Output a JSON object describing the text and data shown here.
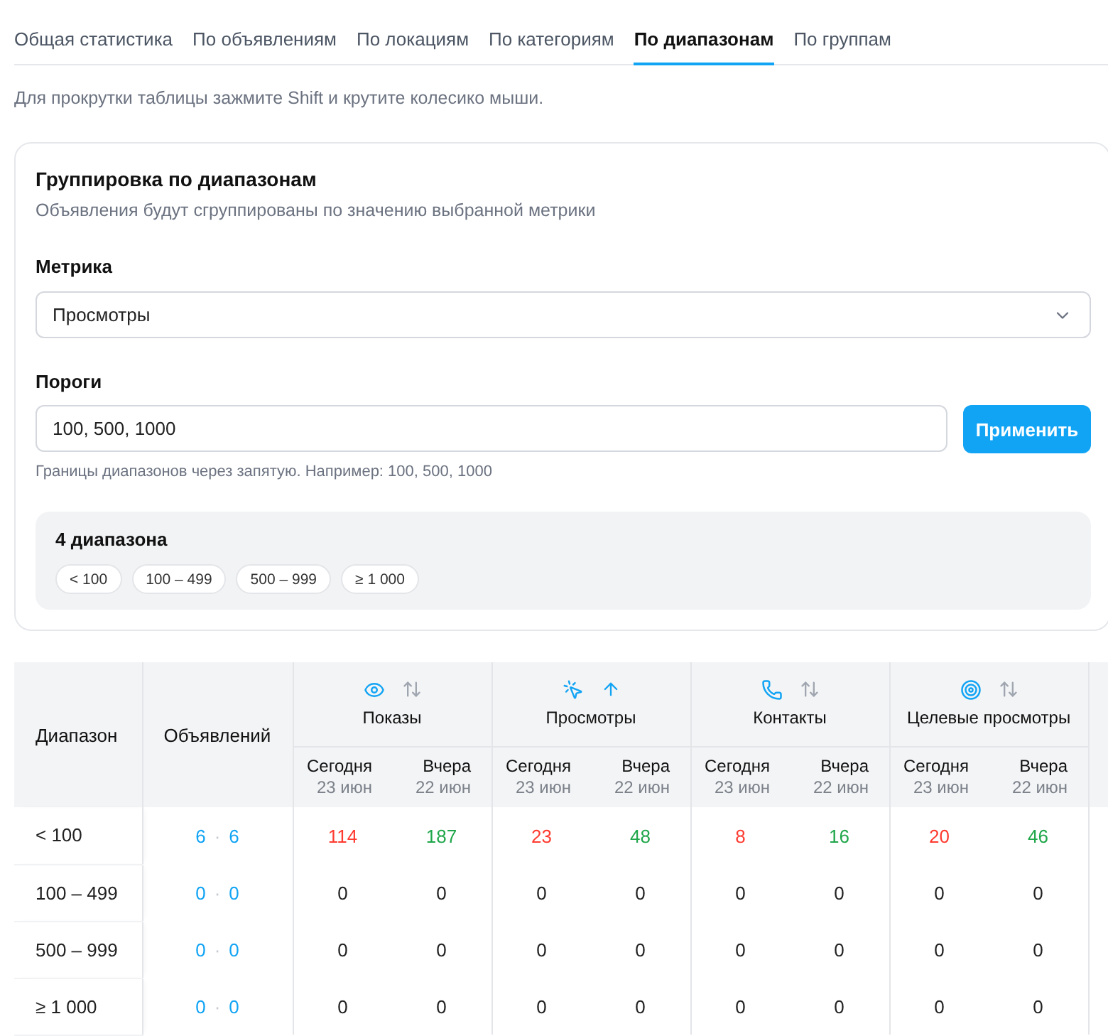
{
  "tabs": [
    {
      "label": "Общая статистика",
      "selected": false
    },
    {
      "label": "По объявлениям",
      "selected": false
    },
    {
      "label": "По локациям",
      "selected": false
    },
    {
      "label": "По категориям",
      "selected": false
    },
    {
      "label": "По диапазонам",
      "selected": true
    },
    {
      "label": "По группам",
      "selected": false
    }
  ],
  "hint": "Для прокрутки таблицы зажмите Shift и крутите колесико мыши.",
  "grouping_card": {
    "title": "Группировка по диапазонам",
    "subtitle": "Объявления будут сгруппированы по значению выбранной метрики",
    "metric": {
      "label": "Метрика",
      "value": "Просмотры"
    },
    "thresholds": {
      "label": "Пороги",
      "value": "100, 500, 1000",
      "help": "Границы диапазонов через запятую. Например: 100, 500, 1000"
    },
    "apply_button": "Применить",
    "summary": {
      "title": "4 диапазона",
      "ranges": [
        "< 100",
        "100 – 499",
        "500 – 999",
        "≥ 1 000"
      ]
    }
  },
  "table": {
    "columns": {
      "range": "Диапазон",
      "ads": "Объявлений"
    },
    "metrics": [
      {
        "kind": "eye",
        "label": "Показы",
        "sorted": false,
        "periods": [
          {
            "label": "Сегодня",
            "date": "23 июн"
          },
          {
            "label": "Вчера",
            "date": "22 июн"
          }
        ]
      },
      {
        "kind": "click",
        "label": "Просмотры",
        "sorted": true,
        "periods": [
          {
            "label": "Сегодня",
            "date": "23 июн"
          },
          {
            "label": "Вчера",
            "date": "22 июн"
          }
        ]
      },
      {
        "kind": "phone",
        "label": "Контакты",
        "sorted": false,
        "periods": [
          {
            "label": "Сегодня",
            "date": "23 июн"
          },
          {
            "label": "Вчера",
            "date": "22 июн"
          }
        ]
      },
      {
        "kind": "target",
        "label": "Целевые просмотры",
        "sorted": false,
        "periods": [
          {
            "label": "Сегодня",
            "date": "23 июн"
          },
          {
            "label": "Вчера",
            "date": "22 июн"
          }
        ]
      }
    ],
    "rows": [
      {
        "range": "< 100",
        "ads": {
          "values": [
            "6",
            "6"
          ],
          "separator": "·"
        },
        "values": [
          {
            "text": "114",
            "color": "#ff3b30"
          },
          {
            "text": "187",
            "color": "#1fa64a"
          },
          {
            "text": "23",
            "color": "#ff3b30"
          },
          {
            "text": "48",
            "color": "#1fa64a"
          },
          {
            "text": "8",
            "color": "#ff3b30"
          },
          {
            "text": "16",
            "color": "#1fa64a"
          },
          {
            "text": "20",
            "color": "#ff3b30"
          },
          {
            "text": "46",
            "color": "#1fa64a"
          }
        ]
      },
      {
        "range": "100 – 499",
        "ads": {
          "values": [
            "0",
            "0"
          ],
          "separator": "·"
        },
        "values": [
          {
            "text": "0",
            "color": "#222222"
          },
          {
            "text": "0",
            "color": "#222222"
          },
          {
            "text": "0",
            "color": "#222222"
          },
          {
            "text": "0",
            "color": "#222222"
          },
          {
            "text": "0",
            "color": "#222222"
          },
          {
            "text": "0",
            "color": "#222222"
          },
          {
            "text": "0",
            "color": "#222222"
          },
          {
            "text": "0",
            "color": "#222222"
          }
        ]
      },
      {
        "range": "500 – 999",
        "ads": {
          "values": [
            "0",
            "0"
          ],
          "separator": "·"
        },
        "values": [
          {
            "text": "0",
            "color": "#222222"
          },
          {
            "text": "0",
            "color": "#222222"
          },
          {
            "text": "0",
            "color": "#222222"
          },
          {
            "text": "0",
            "color": "#222222"
          },
          {
            "text": "0",
            "color": "#222222"
          },
          {
            "text": "0",
            "color": "#222222"
          },
          {
            "text": "0",
            "color": "#222222"
          },
          {
            "text": "0",
            "color": "#222222"
          }
        ]
      },
      {
        "range": "≥ 1 000",
        "ads": {
          "values": [
            "0",
            "0"
          ],
          "separator": "·"
        },
        "values": [
          {
            "text": "0",
            "color": "#222222"
          },
          {
            "text": "0",
            "color": "#222222"
          },
          {
            "text": "0",
            "color": "#222222"
          },
          {
            "text": "0",
            "color": "#222222"
          },
          {
            "text": "0",
            "color": "#222222"
          },
          {
            "text": "0",
            "color": "#222222"
          },
          {
            "text": "0",
            "color": "#222222"
          },
          {
            "text": "0",
            "color": "#222222"
          }
        ]
      }
    ]
  }
}
